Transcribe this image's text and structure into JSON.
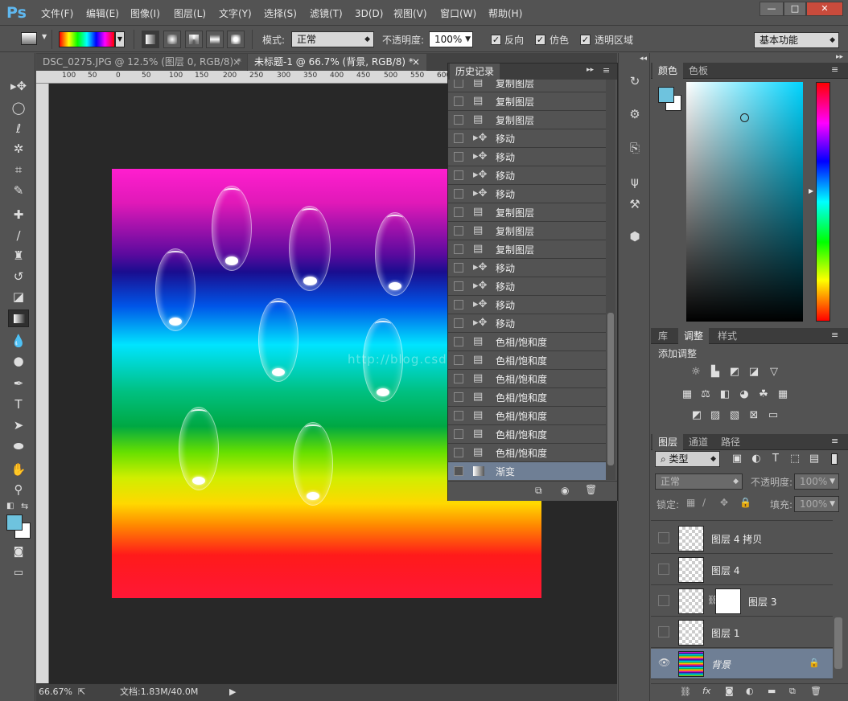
{
  "app": {
    "logo": "Ps"
  },
  "menu": [
    "文件(F)",
    "编辑(E)",
    "图像(I)",
    "图层(L)",
    "文字(Y)",
    "选择(S)",
    "滤镜(T)",
    "3D(D)",
    "视图(V)",
    "窗口(W)",
    "帮助(H)"
  ],
  "window_buttons": [
    "—",
    "□",
    "✕"
  ],
  "options": {
    "mode_label": "模式:",
    "mode_value": "正常",
    "opacity_label": "不透明度:",
    "opacity_value": "100%",
    "reverse_label": "反向",
    "dither_label": "仿色",
    "transparency_label": "透明区域",
    "workspace": "基本功能"
  },
  "tabs": [
    {
      "label": "DSC_0275.JPG @ 12.5% (图层 0, RGB/8) *",
      "close": "×"
    },
    {
      "label": "未标题-1 @ 66.7% (背景, RGB/8) *",
      "close": "×"
    }
  ],
  "ruler_top": [
    "100",
    "50",
    "0",
    "50",
    "100",
    "150",
    "200",
    "250",
    "300",
    "350",
    "400",
    "450",
    "500",
    "550",
    "600"
  ],
  "watermark": "http://blog.csdn.ne",
  "status": {
    "zoom": "66.67%",
    "doc": "文档:1.83M/40.0M",
    "arrow": "▶"
  },
  "history": {
    "title": "历史记录",
    "items": [
      {
        "label": "复制图层",
        "icon": "doc-icon"
      },
      {
        "label": "复制图层",
        "icon": "doc-icon"
      },
      {
        "label": "复制图层",
        "icon": "doc-icon"
      },
      {
        "label": "移动",
        "icon": "move-icon"
      },
      {
        "label": "移动",
        "icon": "move-icon"
      },
      {
        "label": "移动",
        "icon": "move-icon"
      },
      {
        "label": "移动",
        "icon": "move-icon"
      },
      {
        "label": "复制图层",
        "icon": "doc-icon"
      },
      {
        "label": "复制图层",
        "icon": "doc-icon"
      },
      {
        "label": "复制图层",
        "icon": "doc-icon"
      },
      {
        "label": "移动",
        "icon": "move-icon"
      },
      {
        "label": "移动",
        "icon": "move-icon"
      },
      {
        "label": "移动",
        "icon": "move-icon"
      },
      {
        "label": "移动",
        "icon": "move-icon"
      },
      {
        "label": "色相/饱和度",
        "icon": "doc-icon"
      },
      {
        "label": "色相/饱和度",
        "icon": "doc-icon"
      },
      {
        "label": "色相/饱和度",
        "icon": "doc-icon"
      },
      {
        "label": "色相/饱和度",
        "icon": "doc-icon"
      },
      {
        "label": "色相/饱和度",
        "icon": "doc-icon"
      },
      {
        "label": "色相/饱和度",
        "icon": "doc-icon"
      },
      {
        "label": "色相/饱和度",
        "icon": "doc-icon"
      },
      {
        "label": "渐变",
        "icon": "gradient-icon",
        "selected": true
      }
    ]
  },
  "color_panel": {
    "tab_color": "颜色",
    "tab_swatches": "色板",
    "fg_color": "#6ec3de",
    "bg_color": "#ffffff"
  },
  "adjust_panel": {
    "tab_lib": "库",
    "tab_adjust": "调整",
    "tab_styles": "样式",
    "heading": "添加调整"
  },
  "layers_panel": {
    "tab_layers": "图层",
    "tab_channels": "通道",
    "tab_paths": "路径",
    "filter_label": "类型",
    "blend_mode": "正常",
    "opacity_label": "不透明度:",
    "opacity_value": "100%",
    "lock_label": "锁定:",
    "fill_label": "填充:",
    "fill_value": "100%",
    "layers": [
      {
        "name": "图层 4 拷贝",
        "visible": false
      },
      {
        "name": "图层 4",
        "visible": false
      },
      {
        "name": "图层 3",
        "visible": false,
        "mask": true
      },
      {
        "name": "图层 1",
        "visible": false
      },
      {
        "name": "背景",
        "visible": true,
        "selected": true,
        "locked": true
      }
    ]
  }
}
